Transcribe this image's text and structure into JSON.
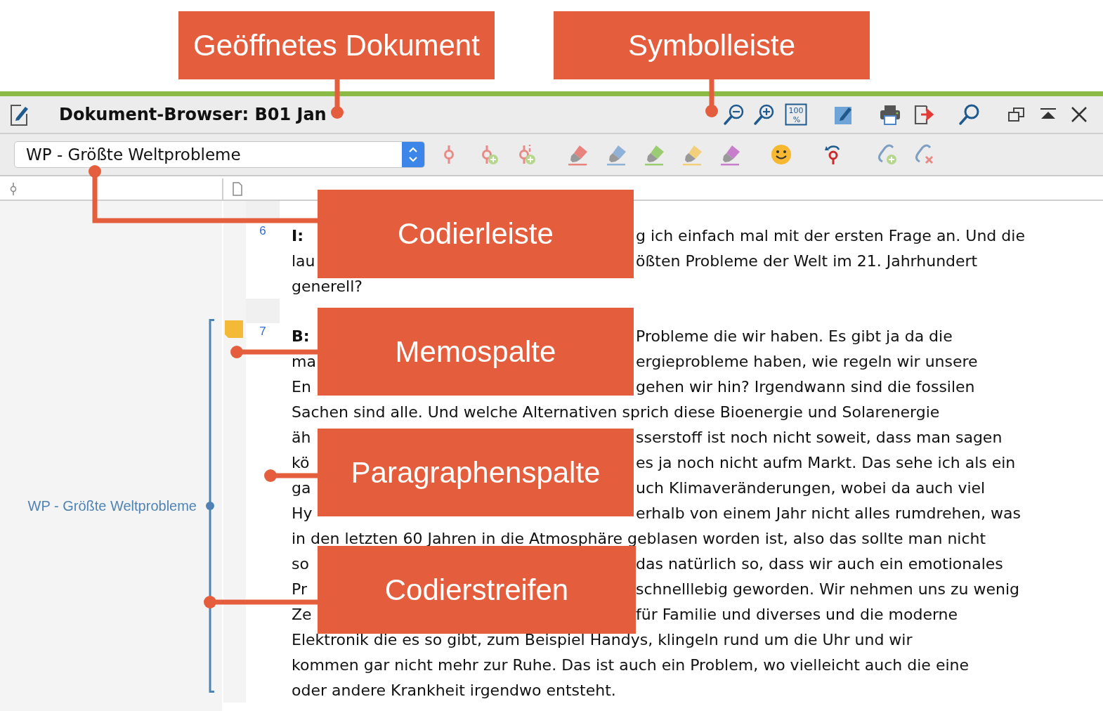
{
  "callouts": [
    {
      "text": "Geöffnetes Dokument"
    },
    {
      "text": "Symbolleiste"
    },
    {
      "text": "Codierleiste"
    },
    {
      "text": "Memospalte"
    },
    {
      "text": "Paragraphenspalte"
    },
    {
      "text": "Codierstreifen"
    }
  ],
  "window": {
    "title": "Dokument-Browser: B01 Jan"
  },
  "title_toolbar": [
    {
      "kind": "zoom-out"
    },
    {
      "kind": "zoom-in"
    },
    {
      "kind": "zoom-reset",
      "label": "100",
      "sub": "%"
    },
    {
      "kind": "memo"
    },
    {
      "kind": "print"
    },
    {
      "kind": "export"
    },
    {
      "kind": "search"
    },
    {
      "kind": "restore"
    },
    {
      "kind": "collapse"
    },
    {
      "kind": "close"
    }
  ],
  "code_selector": {
    "value": "WP - Größte Weltprobleme"
  },
  "coding_toolbar": [
    {
      "kind": "code"
    },
    {
      "kind": "code-add"
    },
    {
      "kind": "code-add-info"
    },
    {
      "kind": "highlighter",
      "color": "#e8847e"
    },
    {
      "kind": "highlighter",
      "color": "#8fb1d8"
    },
    {
      "kind": "highlighter",
      "color": "#9ccc72"
    },
    {
      "kind": "highlighter",
      "color": "#f3cf7c"
    },
    {
      "kind": "highlighter",
      "color": "#c77fcb"
    },
    {
      "kind": "emoticon"
    },
    {
      "kind": "undo-code"
    },
    {
      "kind": "link-add"
    },
    {
      "kind": "link-remove"
    }
  ],
  "paragraphs": [
    {
      "number": "6",
      "memo": false,
      "speaker": "I:",
      "lines": [
        {
          "right": "g ich einfach mal mit der ersten Frage an. Und die"
        },
        {
          "left": "lau",
          "right": "ößten Probleme der Welt im 21. Jahrhundert"
        },
        {
          "full": "generell?"
        }
      ]
    },
    {
      "number": "7",
      "memo": true,
      "speaker": "B:",
      "lines": [
        {
          "right": "Probleme die wir haben. Es gibt ja da die"
        },
        {
          "left": "ma",
          "right": "ergieprobleme haben, wie regeln wir unsere"
        },
        {
          "left": "En",
          "right": "gehen wir hin? Irgendwann sind die fossilen"
        },
        {
          "full": "Sachen sind alle. Und welche Alternativen sprich diese Bioenergie und Solarenergie"
        },
        {
          "left": "äh",
          "right": "sserstoff ist noch nicht soweit, dass man sagen"
        },
        {
          "left": "kö",
          "right": "es ja noch nicht aufm Markt. Das sehe ich als ein"
        },
        {
          "left": "ga",
          "right": "uch Klimaveränderungen, wobei da auch viel"
        },
        {
          "left": "Hy",
          "right": "erhalb von einem Jahr nicht alles rumdrehen, was"
        },
        {
          "full": "in den letzten 60 Jahren in die Atmosphäre geblasen worden ist, also das sollte man nicht"
        },
        {
          "left": "so",
          "right": "das natürlich so, dass wir auch ein emotionales"
        },
        {
          "left": "Pr",
          "right": "schnelllebig geworden. Wir nehmen uns zu wenig"
        },
        {
          "left": "Ze",
          "right": "für Familie und diverses und die moderne"
        },
        {
          "full": "Elektronik die es so gibt, zum Beispiel Handys, klingeln rund um die Uhr und wir"
        },
        {
          "full": "kommen gar nicht mehr zur Ruhe. Das ist auch ein Problem, wo vielleicht auch die eine"
        },
        {
          "full": "oder andere Krankheit irgendwo entsteht."
        }
      ]
    }
  ],
  "code_stripe": {
    "label": "WP - Größte Weltprobleme"
  }
}
